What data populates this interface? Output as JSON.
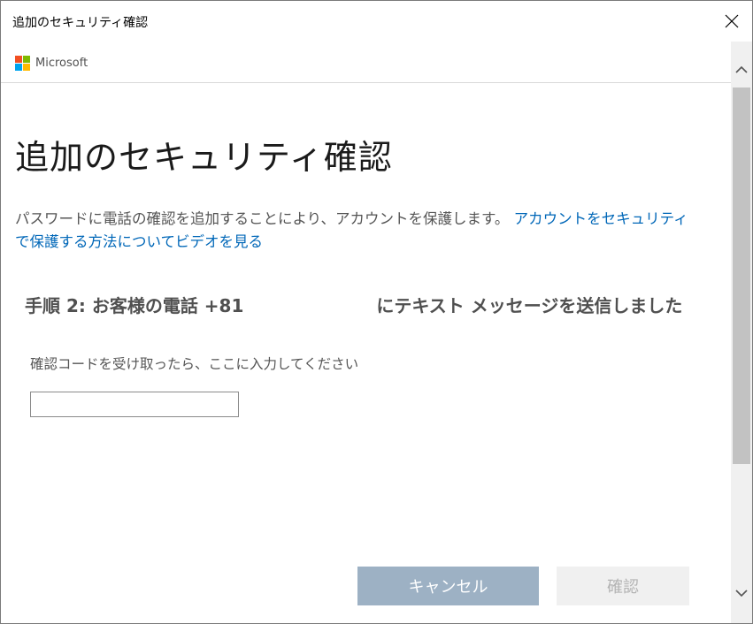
{
  "window": {
    "title": "追加のセキュリティ確認"
  },
  "brand": {
    "name": "Microsoft",
    "logo_colors": [
      "#f25022",
      "#7fba00",
      "#00a4ef",
      "#ffb900"
    ]
  },
  "page": {
    "title": "追加のセキュリティ確認",
    "description": "パスワードに電話の確認を追加することにより、アカウントを保護します。",
    "video_link": "アカウントをセキュリティで保護する方法についてビデオを見る"
  },
  "step": {
    "heading_prefix": "手順 2: お客様の電話 +81",
    "heading_suffix": "にテキスト メッセージを送信しました",
    "instruction": "確認コードを受け取ったら、ここに入力してください",
    "code_value": ""
  },
  "buttons": {
    "cancel_label": "キャンセル",
    "confirm_label": "確認"
  },
  "colors": {
    "link": "#0067b8",
    "cancel_bg": "#9db1c4",
    "confirm_bg": "#f0f0f0"
  },
  "icons": {
    "close": "close-icon",
    "scroll_up": "chevron-up-icon",
    "scroll_down": "chevron-down-icon"
  }
}
